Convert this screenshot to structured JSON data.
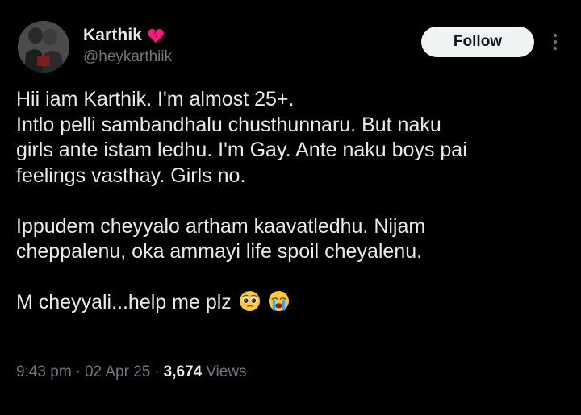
{
  "tweet": {
    "author": {
      "display_name": "Karthik",
      "name_emoji": "broken-heart-icon",
      "handle": "@heykarthiik"
    },
    "follow_label": "Follow",
    "more_icon": "more-vertical-icon",
    "body": {
      "paragraph_1": [
        "Hii iam Karthik. I'm almost 25+.",
        "Intlo pelli sambandhalu chusthunnaru. But naku",
        "girls ante istam ledhu. I'm Gay. Ante naku boys pai",
        "feelings vasthay. Girls no."
      ],
      "paragraph_2": [
        "Ippudem cheyyalo artham kaavatledhu. Nijam",
        "cheppalenu, oka ammayi life spoil cheyalenu."
      ],
      "paragraph_3": "M cheyyali...help me plz",
      "trailing_emojis": [
        "pleading-face-icon",
        "crying-face-icon"
      ]
    },
    "meta": {
      "time": "9:43 pm",
      "separator": "·",
      "date": "02 Apr 25",
      "views_count": "3,674",
      "views_label": "Views"
    }
  },
  "colors": {
    "background": "#000000",
    "primary_text": "#e7e9ea",
    "secondary_text": "#71767b",
    "follow_button_bg": "#eff3f4",
    "follow_button_text": "#0f1419",
    "broken_heart": "#f91880"
  }
}
